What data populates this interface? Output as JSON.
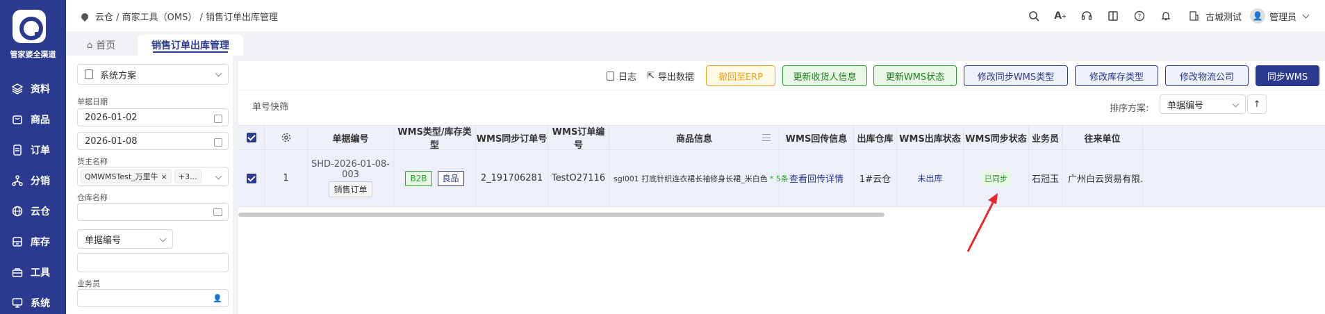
{
  "nav": {
    "brand": "管家婆全渠道",
    "items": [
      {
        "label": "资料",
        "icon": "layers-icon"
      },
      {
        "label": "商品",
        "icon": "box-icon"
      },
      {
        "label": "订单",
        "icon": "document-icon"
      },
      {
        "label": "分销",
        "icon": "network-icon"
      },
      {
        "label": "云仓",
        "icon": "globe-icon"
      },
      {
        "label": "库存",
        "icon": "archive-icon"
      },
      {
        "label": "工具",
        "icon": "toolbox-icon"
      },
      {
        "label": "系统",
        "icon": "monitor-icon"
      }
    ]
  },
  "header": {
    "breadcrumb": "云仓 / 商家工具（OMS） / 销售订单出库管理",
    "org": "古城测试",
    "user": "管理员"
  },
  "tabs": [
    {
      "label": "首页"
    },
    {
      "label": "销售订单出库管理"
    }
  ],
  "filters": {
    "scheme": "系统方案",
    "date_label": "单据日期",
    "date_from": "2026-01-02",
    "date_to": "2026-01-08",
    "owner_label": "货主名称",
    "owner_tag": "QMWMSTest_万里牛",
    "owner_more": "+3...",
    "warehouse_label": "仓库名称",
    "doc_type": "单据编号",
    "salesman_label": "业务员"
  },
  "toolbar": {
    "log": "日志",
    "export": "导出数据",
    "buttons": [
      {
        "label": "撤回至ERP",
        "style": "orange"
      },
      {
        "label": "更新收货人信息",
        "style": "green"
      },
      {
        "label": "更新WMS状态",
        "style": "green"
      },
      {
        "label": "修改同步WMS类型",
        "style": "blue"
      },
      {
        "label": "修改库存类型",
        "style": "blue"
      },
      {
        "label": "修改物流公司",
        "style": "blue"
      },
      {
        "label": "同步WMS",
        "style": "primary"
      }
    ]
  },
  "quick": {
    "label": "单号快筛",
    "sort_label": "排序方案:",
    "sort_value": "单据编号"
  },
  "table": {
    "columns": [
      "单据编号",
      "WMS类型/库存类型",
      "WMS同步订单号",
      "WMS订单编号",
      "商品信息",
      "WMS回传信息",
      "出库仓库",
      "WMS出库状态",
      "WMS同步状态",
      "业务员",
      "往来单位"
    ],
    "rows": [
      {
        "index": "1",
        "doc_no": "SHD-2026-01-08-003",
        "doc_type": "销售订单",
        "wms_type": "B2B",
        "stock_type": "良品",
        "sync_order": "2_191706281",
        "wms_order": "TestO27116",
        "goods": "sgl001 打底针织连衣裙长袖修身长裙_米白色",
        "goods_count": "* 5条",
        "feedback": "查看回传详情",
        "warehouse": "1#云仓",
        "out_status": "未出库",
        "sync_status": "已同步",
        "salesman": "石冠玉",
        "partner": "广州白云贸易有限..."
      }
    ]
  },
  "colors": {
    "brand": "#2b3a8f",
    "green": "#2aa22a",
    "orange": "#f0a020",
    "arrow": "#e8262b"
  }
}
